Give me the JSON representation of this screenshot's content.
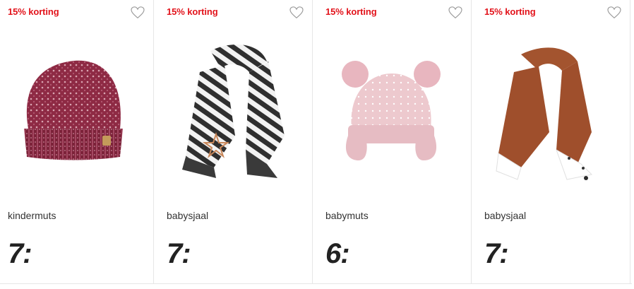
{
  "products": [
    {
      "badge": "15% korting",
      "name": "kindermuts",
      "price": "7:"
    },
    {
      "badge": "15% korting",
      "name": "babysjaal",
      "price": "7:"
    },
    {
      "badge": "15% korting",
      "name": "babymuts",
      "price": "6:"
    },
    {
      "badge": "15% korting",
      "name": "babysjaal",
      "price": "7:"
    }
  ],
  "colors": {
    "badge": "#e2131b",
    "price": "#222222",
    "name": "#333333",
    "divider": "#e6e6e6"
  },
  "icons": [
    "heart-icon"
  ]
}
